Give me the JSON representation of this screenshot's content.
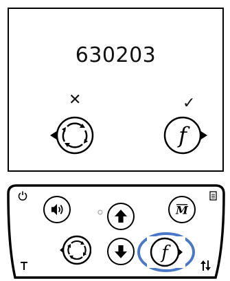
{
  "display": {
    "code": "630203",
    "cancel_mark": "✕",
    "confirm_mark": "✓",
    "left_icon": "circle-arrows-icon",
    "right_icon": "function-icon"
  },
  "keypad": {
    "function_key_label": "f",
    "highlight_color": "#4a78c8",
    "keys": [
      {
        "name": "volume-key",
        "icon": "speaker-icon"
      },
      {
        "name": "up-key",
        "icon": "arrow-up-icon"
      },
      {
        "name": "menu-key",
        "icon": "m-logo-icon"
      },
      {
        "name": "circle-key",
        "icon": "circle-arrows-icon"
      },
      {
        "name": "down-key",
        "icon": "arrow-down-icon"
      },
      {
        "name": "function-key",
        "icon": "function-icon"
      }
    ],
    "side_icons": [
      "power-icon",
      "document-icon",
      "temperature-icon",
      "swap-icon"
    ]
  }
}
